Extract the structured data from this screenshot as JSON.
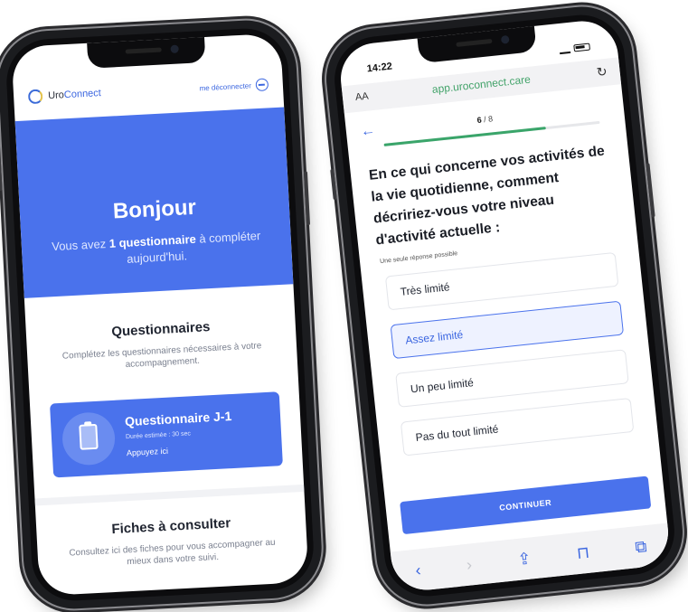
{
  "left_phone": {
    "header": {
      "logo_text_prefix": "Uro",
      "logo_text_suffix": "Connect",
      "logout_label": "me déconnecter"
    },
    "hero": {
      "greeting": "Bonjour",
      "line_prefix": "Vous avez ",
      "line_bold": "1 questionnaire",
      "line_suffix": " à compléter aujourd'hui."
    },
    "questionnaires": {
      "title": "Questionnaires",
      "subtitle": "Complétez les questionnaires nécessaires à votre accompagnement.",
      "card": {
        "title": "Questionnaire J-1",
        "duration": "Durée estimée : 30 sec",
        "action": "Appuyez ici"
      }
    },
    "fiches": {
      "title": "Fiches à consulter",
      "subtitle": "Consultez ici des fiches pour vous accompagner au mieux dans votre suivi."
    }
  },
  "right_phone": {
    "status_bar": {
      "time": "14:22"
    },
    "browser": {
      "text_size_label": "AA",
      "url": "app.uroconnect.care",
      "reload_icon": "reload-icon"
    },
    "progress": {
      "current": "6",
      "total": "/ 8",
      "fraction": 0.75
    },
    "question": "En ce qui concerne vos activités de la vie quotidienne, comment décririez-vous votre niveau d'activité actuelle :",
    "hint": "Une seule réponse possible",
    "options": [
      "Très limité",
      "Assez limité",
      "Un peu limité",
      "Pas du tout limité"
    ],
    "selected_option": "Assez limité",
    "continue_label": "CONTINUER",
    "toolbar_icons": [
      "back-icon",
      "forward-icon",
      "share-icon",
      "bookmarks-icon",
      "tabs-icon"
    ]
  },
  "colors": {
    "brand_blue": "#4a72ec",
    "progress_green": "#3aa56a",
    "url_green": "#43a36a"
  }
}
